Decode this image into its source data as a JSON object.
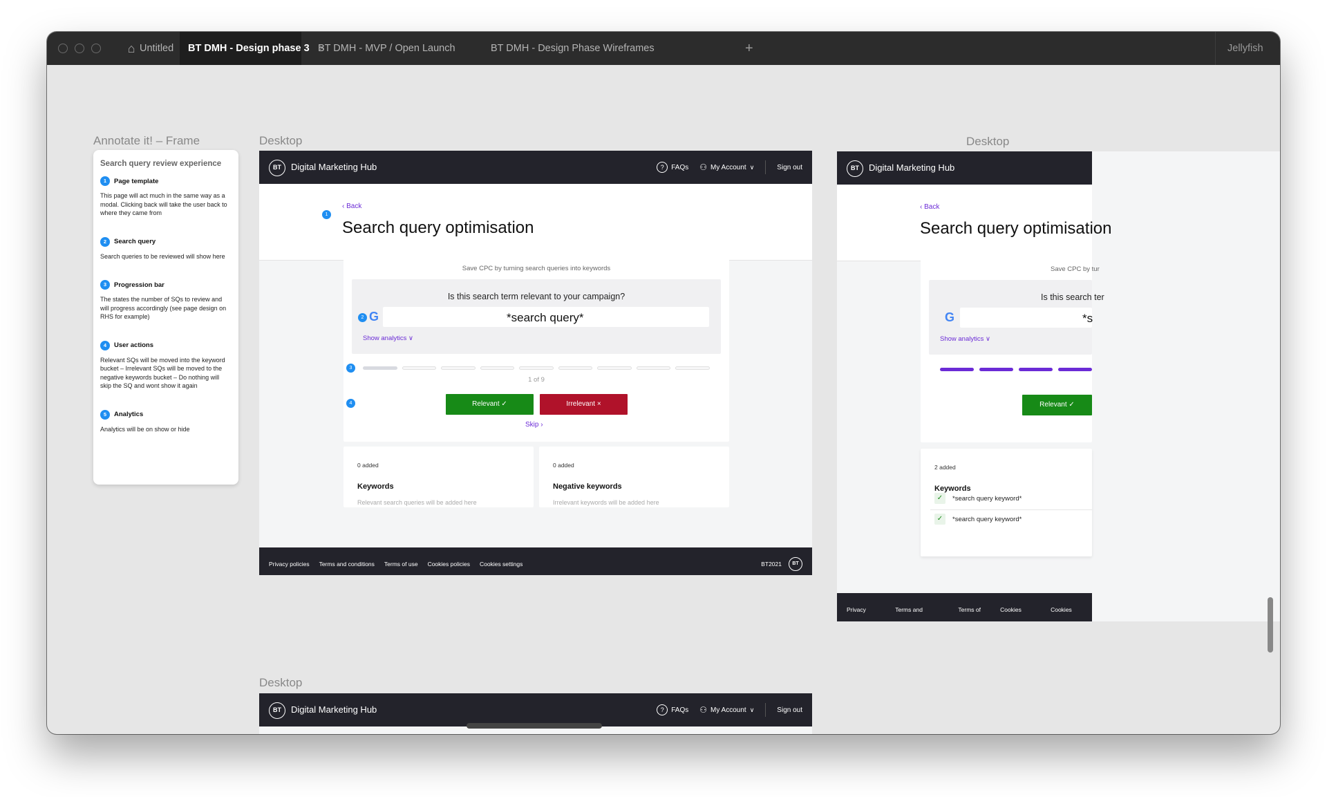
{
  "titlebar": {
    "tabs": [
      "Untitled",
      "BT DMH - Design phase 3",
      "BT DMH - MVP / Open Launch",
      "BT DMH - Design Phase Wireframes"
    ],
    "close_glyph": "×",
    "new_tab_glyph": "+",
    "team": "Jellyfish"
  },
  "frame_labels": {
    "annotate": "Annotate it! – Frame",
    "desktop1": "Desktop",
    "desktop2": "Desktop",
    "desktop3": "Desktop"
  },
  "annotation": {
    "heading": "Search query review experience",
    "items": [
      {
        "num": "1",
        "title": "Page template",
        "body": "This page will act much in the same way as a modal. Clicking back will take the user back to where they came from"
      },
      {
        "num": "2",
        "title": "Search query",
        "body": "Search queries to be reviewed will show here"
      },
      {
        "num": "3",
        "title": "Progression bar",
        "body": "The states the number of SQs to review and will progress accordingly (see page design on RHS for example)"
      },
      {
        "num": "4",
        "title": "User actions",
        "body": "Relevant SQs will be moved into the keyword bucket – Irrelevant SQs will be moved to the negative keywords bucket – Do nothing will skip the SQ and wont show it again"
      },
      {
        "num": "5",
        "title": "Analytics",
        "body": "Analytics will be on show or hide"
      }
    ]
  },
  "header": {
    "logo": "BT",
    "brand": "Digital Marketing Hub",
    "faqs": "FAQs",
    "account": "My Account",
    "signout": "Sign out"
  },
  "page": {
    "back": "Back",
    "title": "Search query optimisation",
    "subtitle": "Save CPC by turning search queries into keywords",
    "question": "Is this search term relevant to your campaign?",
    "google_glyph": "G",
    "search_query": "*search query*",
    "show_analytics": "Show analytics",
    "progress_text": "1 of 9",
    "progress": {
      "current": 1,
      "total": 9
    },
    "relevant": "Relevant",
    "irrelevant": "Irrelevant",
    "skip": "Skip",
    "badges": [
      "1",
      "2",
      "3",
      "4"
    ]
  },
  "keywords": {
    "count": "0 added",
    "title": "Keywords",
    "hint": "Relevant search queries will be added here"
  },
  "negative_keywords": {
    "count": "0 added",
    "title": "Negative keywords",
    "hint": "Irrelevant keywords  will be added here"
  },
  "right_frame": {
    "subtitle_partial": "Save CPC by tur",
    "question_partial": "Is this search ter",
    "query_partial": "*s",
    "keywords_count": "2 added",
    "keywords_title": "Keywords",
    "keyword_items": [
      "*search query keyword*",
      "*search query keyword*"
    ]
  },
  "footer": {
    "links": [
      "Privacy policies",
      "Terms and conditions",
      "Terms of use",
      "Cookies policies",
      "Cookies settings"
    ],
    "copyright": "BT2021"
  },
  "colors": {
    "accent_purple": "#6b2bd6",
    "relevant_green": "#178a17",
    "irrelevant_red": "#b0122a",
    "header_dark": "#23232b",
    "annotation_blue": "#1f8ef1"
  }
}
